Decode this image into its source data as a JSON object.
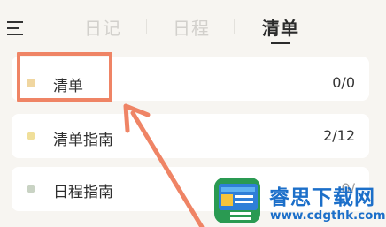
{
  "header": {
    "menu_icon": "hamburger-menu-icon",
    "tabs": [
      {
        "label": "日记",
        "active": false
      },
      {
        "label": "日程",
        "active": false
      },
      {
        "label": "清单",
        "active": true
      }
    ]
  },
  "list": {
    "items": [
      {
        "label": "清单",
        "count": "0/0",
        "color": "#f0d6a0"
      },
      {
        "label": "清单指南",
        "count": "2/12",
        "color": "#f0df9a"
      },
      {
        "label": "日程指南",
        "count": "0/",
        "color": "#c9d3c4"
      }
    ]
  },
  "annotation": {
    "color": "#ef8465"
  },
  "watermark": {
    "title": "睿思下载网",
    "url": "www.cdgthk.com",
    "color": "#1c6fc9"
  }
}
